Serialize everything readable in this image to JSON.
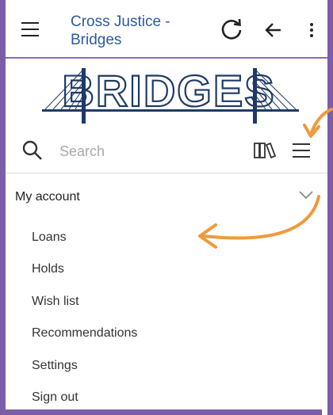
{
  "app": {
    "title_line1": "Cross Justice -",
    "title_line2": "Bridges"
  },
  "logo": {
    "text": "BRIDGES"
  },
  "search": {
    "placeholder": "Search"
  },
  "account": {
    "title": "My account",
    "items": [
      {
        "label": "Loans"
      },
      {
        "label": "Holds"
      },
      {
        "label": "Wish list"
      },
      {
        "label": "Recommendations"
      },
      {
        "label": "Settings"
      },
      {
        "label": "Sign out"
      }
    ]
  },
  "colors": {
    "accent": "#2c5aa0",
    "frame": "#7b5ea7",
    "annotation": "#ef9a3c",
    "logo": "#1f3a66"
  },
  "icons": [
    "hamburger-icon",
    "reload-icon",
    "back-arrow-icon",
    "more-vert-icon",
    "search-icon",
    "books-icon",
    "menu-icon",
    "chevron-down-icon"
  ]
}
